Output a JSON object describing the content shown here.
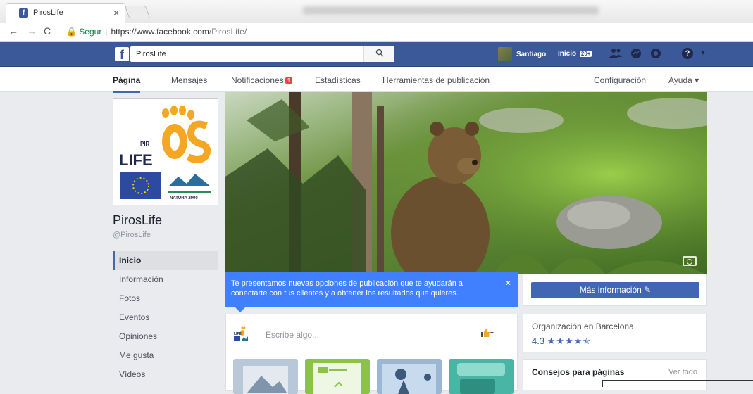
{
  "browser": {
    "tab_title": "PirosLife",
    "tab_close": "×",
    "url_secure_label": "Segur",
    "url_host": "https://www.facebook.com",
    "url_path": "/PirosLife/"
  },
  "fb_header": {
    "logo": "f",
    "search_value": "PirosLife",
    "user_name": "Santiago",
    "home_label": "Inicio",
    "home_badge": "20+"
  },
  "page_tabs": {
    "page": "Página",
    "messages": "Mensajes",
    "notifications": "Notificaciones",
    "notifications_badge": "1",
    "stats": "Estadísticas",
    "publishing_tools": "Herramientas de publicación",
    "settings": "Configuración",
    "help": "Ayuda ▾"
  },
  "profile": {
    "name": "PirosLife",
    "handle": "@PirosLife"
  },
  "left_nav": [
    {
      "label": "Inicio",
      "active": true
    },
    {
      "label": "Información"
    },
    {
      "label": "Fotos"
    },
    {
      "label": "Eventos"
    },
    {
      "label": "Opiniones"
    },
    {
      "label": "Me gusta"
    },
    {
      "label": "Vídeos"
    }
  ],
  "tooltip": {
    "text": "Te presentamos nuevas opciones de publicación que te ayudarán a conectarte con tus clientes y a obtener los resultados que quieres.",
    "close": "×"
  },
  "right": {
    "more_info_button": "Más información",
    "org_type": "Organización en Barcelona",
    "rating_value": "4.3",
    "rating_stars": "★★★★✯",
    "tips_title": "Consejos para páginas",
    "tips_link": "Ver todo"
  },
  "composer": {
    "placeholder": "Escribe algo..."
  },
  "colors": {
    "fb_blue": "#3b5998",
    "button_blue": "#4267b2",
    "tooltip_blue": "#4080ff"
  }
}
